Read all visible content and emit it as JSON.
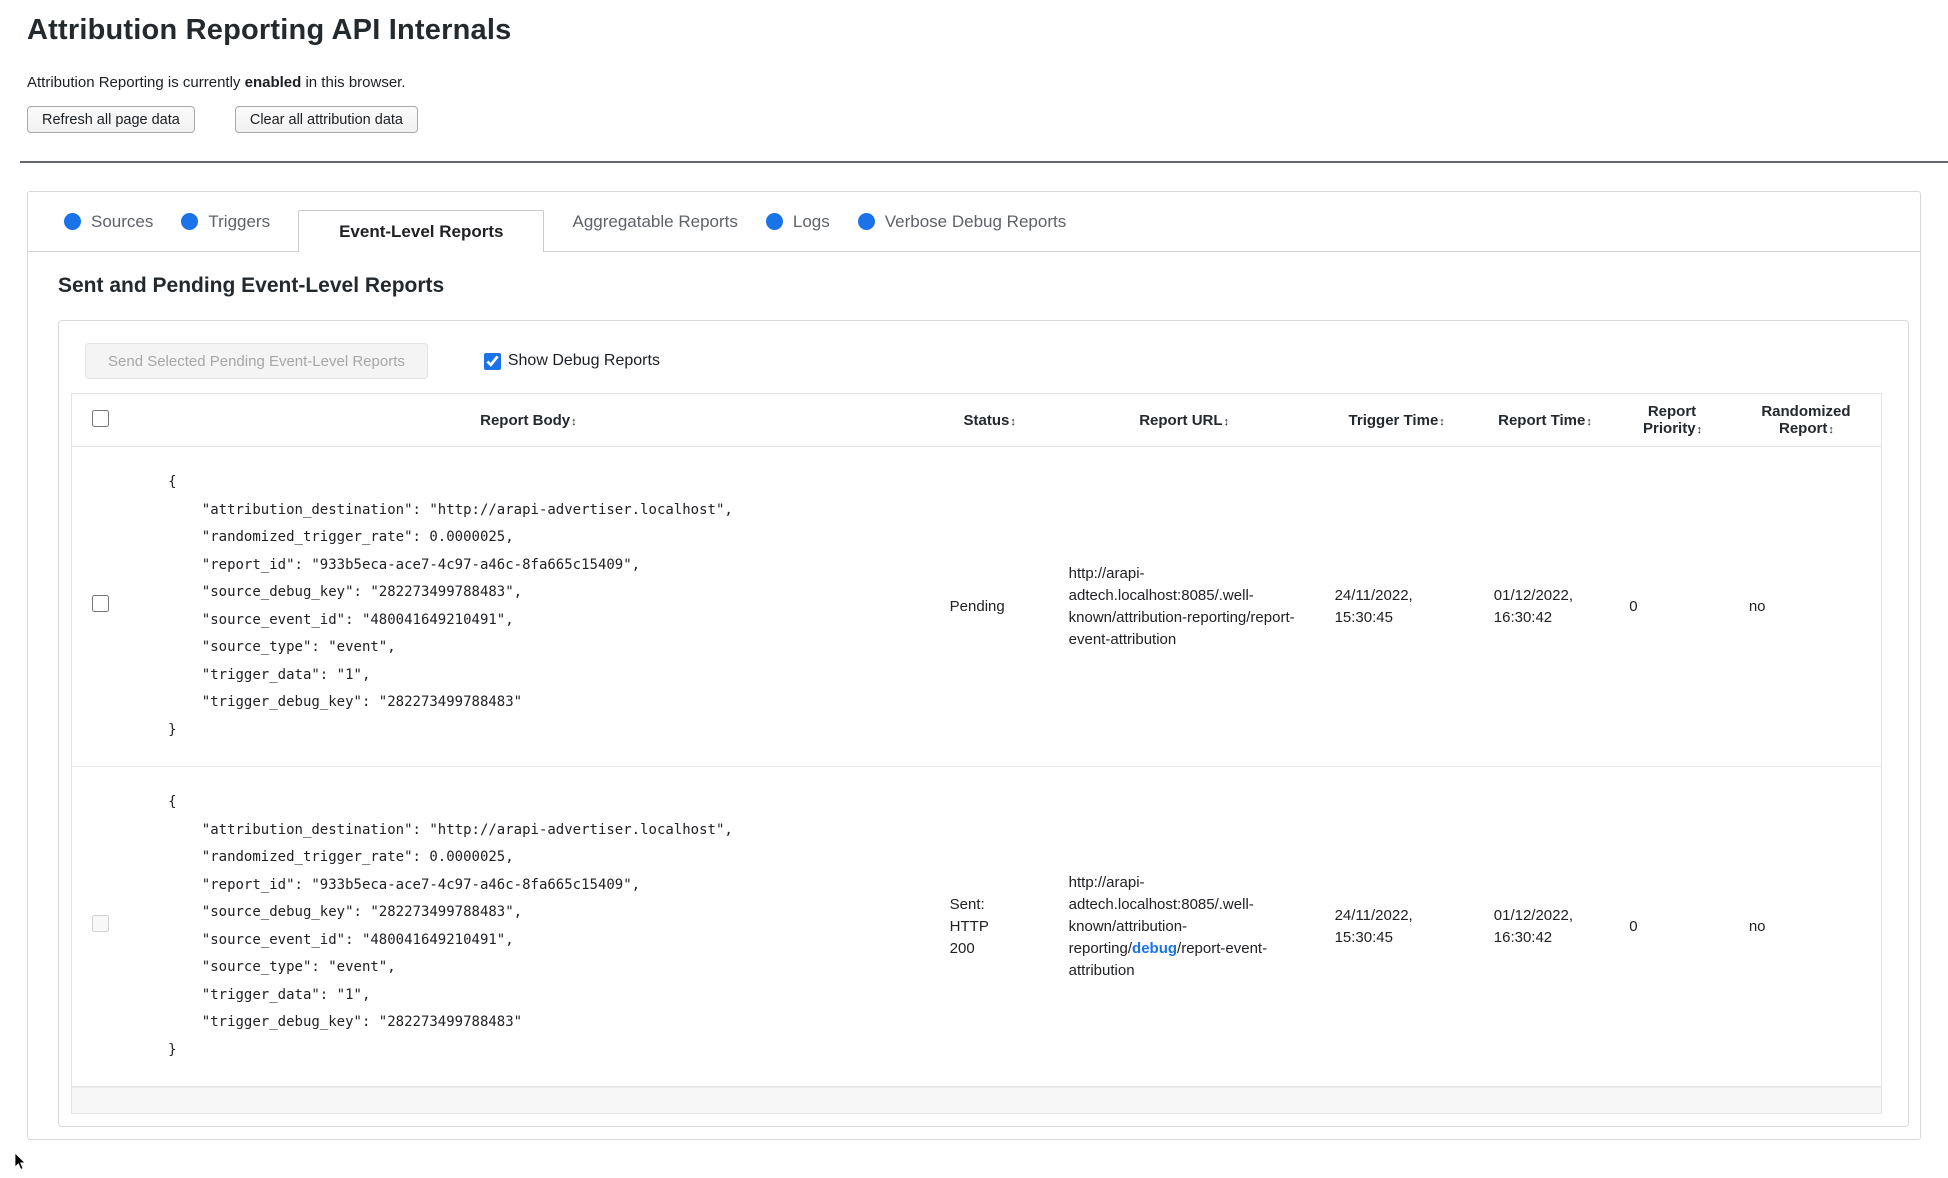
{
  "colors": {
    "accent_blue": "#1a73e8",
    "tab_dot": "#1a73e8",
    "debug_link": "#1a73e8",
    "heading_text": "#24292e"
  },
  "header": {
    "title": "Attribution Reporting API Internals",
    "status_prefix": "Attribution Reporting is currently ",
    "status_emphasis": "enabled",
    "status_suffix": " in this browser.",
    "refresh_button": "Refresh all page data",
    "clear_button": "Clear all attribution data"
  },
  "tabs": [
    {
      "label": "Sources",
      "has_dot": true,
      "selected": false
    },
    {
      "label": "Triggers",
      "has_dot": true,
      "selected": false
    },
    {
      "label": "Event-Level Reports",
      "has_dot": false,
      "selected": true
    },
    {
      "label": "Aggregatable Reports",
      "has_dot": false,
      "selected": false
    },
    {
      "label": "Logs",
      "has_dot": true,
      "selected": false
    },
    {
      "label": "Verbose Debug Reports",
      "has_dot": true,
      "selected": false
    }
  ],
  "section": {
    "heading": "Sent and Pending Event-Level Reports",
    "send_button": "Send Selected Pending Event-Level Reports",
    "send_button_enabled": false,
    "show_debug_label": "Show Debug Reports",
    "show_debug_checked": true
  },
  "table": {
    "sort_icon": "↕",
    "columns": {
      "report_body": "Report Body",
      "status": "Status",
      "report_url": "Report URL",
      "trigger_time": "Trigger Time",
      "report_time": "Report Time",
      "report_priority": "Report Priority",
      "randomized_report": "Randomized Report"
    },
    "select_all_checked": false,
    "rows": [
      {
        "selected": false,
        "selectable": true,
        "report_body": "{\n    \"attribution_destination\": \"http://arapi-advertiser.localhost\",\n    \"randomized_trigger_rate\": 0.0000025,\n    \"report_id\": \"933b5eca-ace7-4c97-a46c-8fa665c15409\",\n    \"source_debug_key\": \"282273499788483\",\n    \"source_event_id\": \"480041649210491\",\n    \"source_type\": \"event\",\n    \"trigger_data\": \"1\",\n    \"trigger_debug_key\": \"282273499788483\"\n}",
        "status": "Pending",
        "report_url_prefix": "http://arapi-adtech.localhost:8085/.well-known/attribution-reporting/",
        "report_url_debug": "",
        "report_url_suffix": "report-event-attribution",
        "trigger_time": "24/11/2022, 15:30:45",
        "report_time": "01/12/2022, 16:30:42",
        "report_priority": "0",
        "randomized_report": "no"
      },
      {
        "selected": false,
        "selectable": false,
        "report_body": "{\n    \"attribution_destination\": \"http://arapi-advertiser.localhost\",\n    \"randomized_trigger_rate\": 0.0000025,\n    \"report_id\": \"933b5eca-ace7-4c97-a46c-8fa665c15409\",\n    \"source_debug_key\": \"282273499788483\",\n    \"source_event_id\": \"480041649210491\",\n    \"source_type\": \"event\",\n    \"trigger_data\": \"1\",\n    \"trigger_debug_key\": \"282273499788483\"\n}",
        "status": "Sent: HTTP 200",
        "report_url_prefix": "http://arapi-adtech.localhost:8085/.well-known/attribution-reporting/",
        "report_url_debug": "debug",
        "report_url_suffix": "/report-event-attribution",
        "trigger_time": "24/11/2022, 15:30:45",
        "report_time": "01/12/2022, 16:30:42",
        "report_priority": "0",
        "randomized_report": "no"
      }
    ]
  }
}
